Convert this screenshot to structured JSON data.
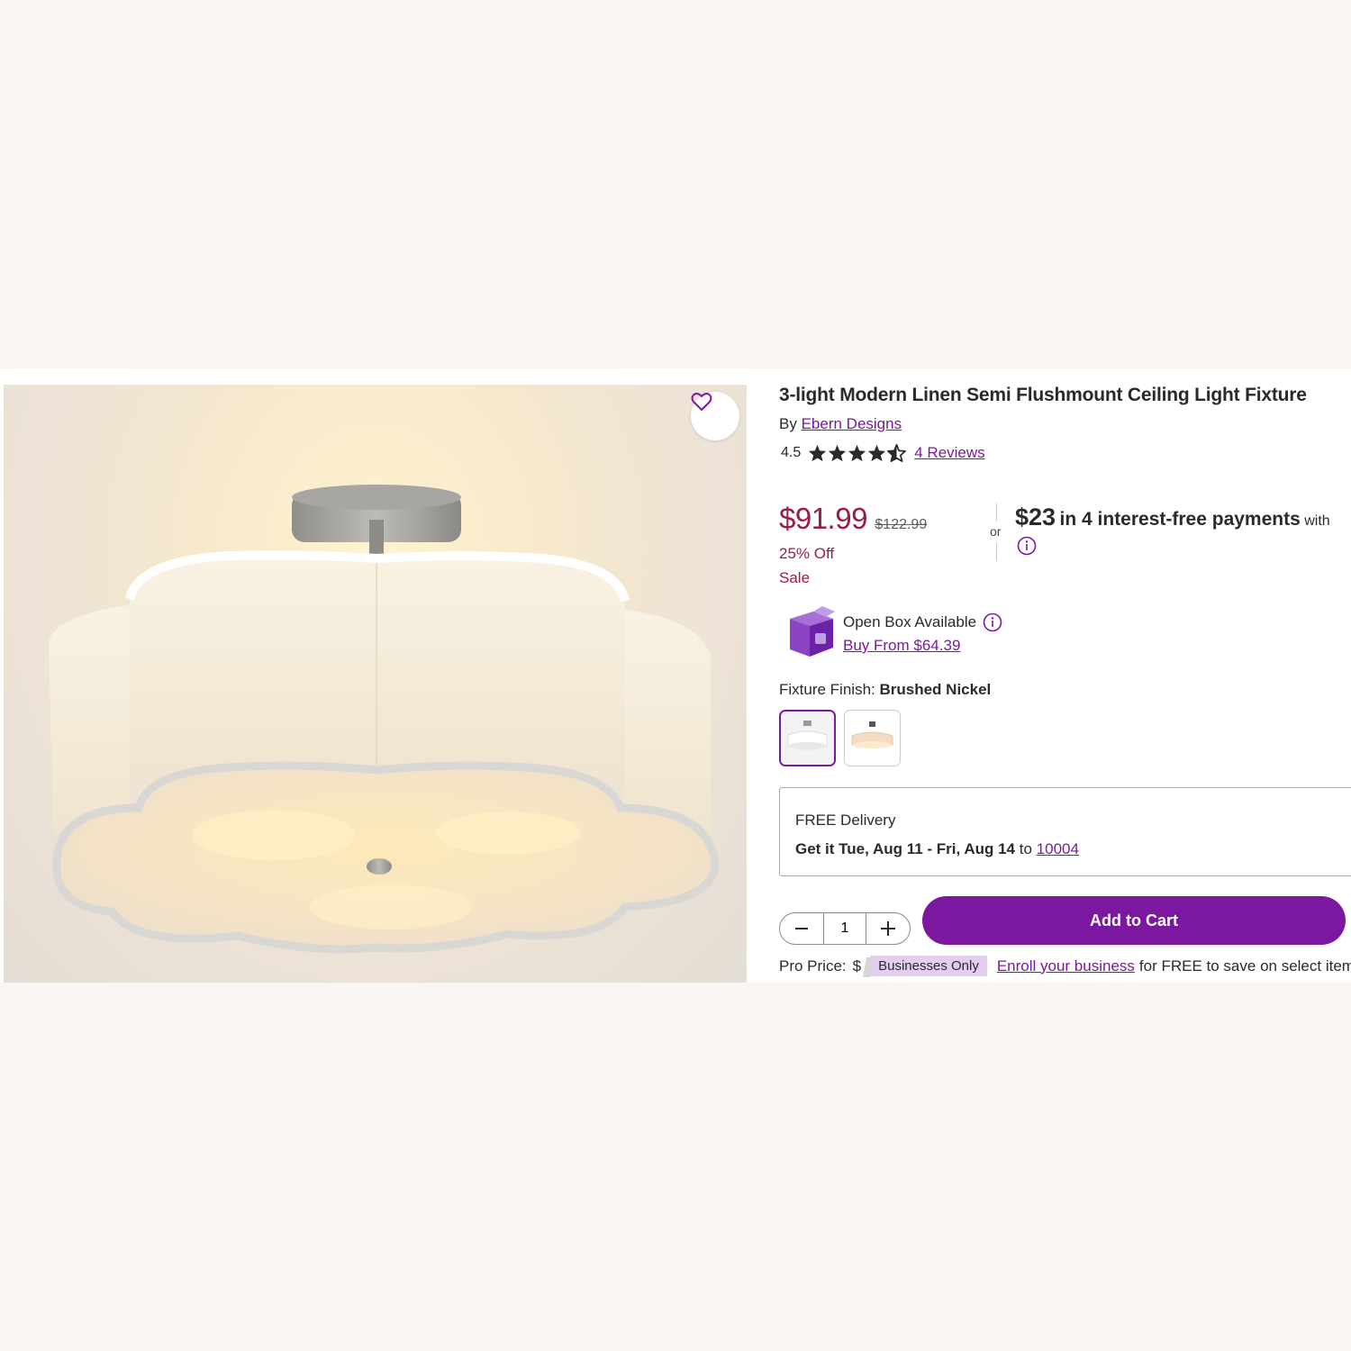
{
  "product": {
    "title": "3-light Modern Linen Semi Flushmount Ceiling Light Fixture",
    "by_prefix": "By",
    "brand": "Ebern Designs",
    "rating": "4.5",
    "rating_value": 4.5,
    "rating_max": 5,
    "reviews_link": "4 Reviews"
  },
  "pricing": {
    "current": "$91.99",
    "original": "$122.99",
    "discount": "25% Off",
    "sale_label": "Sale",
    "or_label": "or",
    "installment_amount": "$23",
    "installment_text": "in 4 interest-free payments",
    "installment_with": "with"
  },
  "open_box": {
    "title": "Open Box Available",
    "link": "Buy From $64.39"
  },
  "finish": {
    "label": "Fixture Finish:",
    "selected": "Brushed Nickel",
    "options_count": 2,
    "selected_index": 0
  },
  "delivery": {
    "label": "FREE Delivery",
    "date": "Get it Tue, Aug 11 - Fri, Aug 14",
    "to_word": "to",
    "zip": "10004"
  },
  "cart": {
    "quantity": "1",
    "add_button": "Add to Cart"
  },
  "pro": {
    "label": "Pro Price:",
    "price_partial": "$",
    "badge": "Businesses Only",
    "enroll_link": "Enroll your business",
    "enroll_text": "for FREE to save on select item"
  },
  "colors": {
    "accent": "#7b189f",
    "sale": "#9b1b4a",
    "page_bg": "#f8f5f2"
  },
  "icons": [
    "heart-icon",
    "star-icon",
    "info-icon",
    "open-box-icon",
    "minus-icon",
    "plus-icon"
  ]
}
